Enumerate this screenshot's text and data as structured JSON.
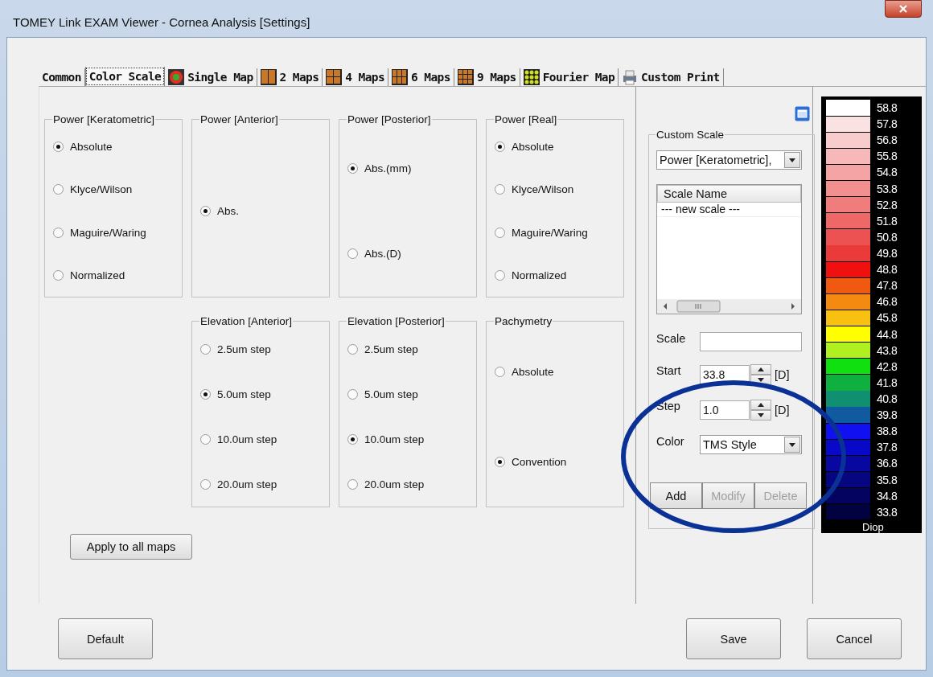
{
  "window": {
    "title": "TOMEY Link EXAM Viewer - Cornea Analysis [Settings]"
  },
  "tabs": [
    {
      "label": "Common",
      "selected": false,
      "kind": "plain"
    },
    {
      "label": "Color Scale",
      "selected": true,
      "kind": "plain"
    },
    {
      "label": "Single Map",
      "selected": false,
      "kind": "single"
    },
    {
      "label": "2 Maps",
      "selected": false,
      "kind": "grid2"
    },
    {
      "label": "4 Maps",
      "selected": false,
      "kind": "grid4"
    },
    {
      "label": "6 Maps",
      "selected": false,
      "kind": "grid6"
    },
    {
      "label": "9 Maps",
      "selected": false,
      "kind": "grid9"
    },
    {
      "label": "Fourier Map",
      "selected": false,
      "kind": "fourier"
    },
    {
      "label": "Custom Print",
      "selected": false,
      "kind": "print"
    }
  ],
  "group_rows": [
    [
      {
        "title": "Power [Keratometric]",
        "options": [
          {
            "label": "Absolute",
            "selected": true
          },
          {
            "label": "Klyce/Wilson",
            "selected": false
          },
          {
            "label": "Maguire/Waring",
            "selected": false
          },
          {
            "label": "Normalized",
            "selected": false
          }
        ]
      },
      {
        "title": "Power [Anterior]",
        "options": [
          {
            "label": "Abs.",
            "selected": true
          }
        ]
      },
      {
        "title": "Power [Posterior]",
        "options": [
          {
            "label": "Abs.(mm)",
            "selected": true
          },
          {
            "label": "Abs.(D)",
            "selected": false
          }
        ]
      },
      {
        "title": "Power [Real]",
        "options": [
          {
            "label": "Absolute",
            "selected": true
          },
          {
            "label": "Klyce/Wilson",
            "selected": false
          },
          {
            "label": "Maguire/Waring",
            "selected": false
          },
          {
            "label": "Normalized",
            "selected": false
          }
        ]
      }
    ],
    [
      {
        "title": "Elevation [Anterior]",
        "options": [
          {
            "label": "2.5um step",
            "selected": false
          },
          {
            "label": "5.0um step",
            "selected": true
          },
          {
            "label": "10.0um step",
            "selected": false
          },
          {
            "label": "20.0um step",
            "selected": false
          }
        ]
      },
      {
        "title": "Elevation [Posterior]",
        "options": [
          {
            "label": "2.5um step",
            "selected": false
          },
          {
            "label": "5.0um step",
            "selected": false
          },
          {
            "label": "10.0um step",
            "selected": true
          },
          {
            "label": "20.0um step",
            "selected": false
          }
        ]
      },
      {
        "title": "Pachymetry",
        "options": [
          {
            "label": "Absolute",
            "selected": false
          },
          {
            "label": "Convention",
            "selected": true
          }
        ]
      }
    ]
  ],
  "apply_button": "Apply to all maps",
  "custom_scale": {
    "title": "Custom Scale",
    "scale_type": "Power [Keratometric],",
    "list": {
      "column": "Scale Name",
      "rows": [
        "--- new scale ---"
      ]
    },
    "scale": {
      "label": "Scale"
    },
    "start": {
      "label": "Start",
      "value": "33.8",
      "unit": "[D]"
    },
    "step": {
      "label": "Step",
      "value": "1.0",
      "unit": "[D]"
    },
    "color": {
      "label": "Color",
      "value": "TMS Style"
    },
    "buttons": [
      {
        "label": "Add",
        "disabled": false
      },
      {
        "label": "Modify",
        "disabled": true
      },
      {
        "label": "Delete",
        "disabled": true
      }
    ]
  },
  "color_bar": {
    "unit": "Diop",
    "bands": [
      {
        "label": "58.8",
        "color": "#ffffff"
      },
      {
        "label": "57.8",
        "color": "#fbe2e2"
      },
      {
        "label": "56.8",
        "color": "#f8cccc"
      },
      {
        "label": "55.8",
        "color": "#f6b8b8"
      },
      {
        "label": "54.8",
        "color": "#f4a4a4"
      },
      {
        "label": "53.8",
        "color": "#f29090"
      },
      {
        "label": "52.8",
        "color": "#f07c7c"
      },
      {
        "label": "51.8",
        "color": "#ee6868"
      },
      {
        "label": "50.8",
        "color": "#ec5252"
      },
      {
        "label": "49.8",
        "color": "#ea3a3a"
      },
      {
        "label": "48.8",
        "color": "#f01010"
      },
      {
        "label": "47.8",
        "color": "#f05a10"
      },
      {
        "label": "46.8",
        "color": "#f58a10"
      },
      {
        "label": "45.8",
        "color": "#f8c010"
      },
      {
        "label": "44.8",
        "color": "#ffff00"
      },
      {
        "label": "43.8",
        "color": "#b0f020"
      },
      {
        "label": "42.8",
        "color": "#10e010"
      },
      {
        "label": "41.8",
        "color": "#10b040"
      },
      {
        "label": "40.8",
        "color": "#109070"
      },
      {
        "label": "39.8",
        "color": "#105aa0"
      },
      {
        "label": "38.8",
        "color": "#1010f0"
      },
      {
        "label": "37.8",
        "color": "#0808c8"
      },
      {
        "label": "36.8",
        "color": "#0808a0"
      },
      {
        "label": "35.8",
        "color": "#060680"
      },
      {
        "label": "34.8",
        "color": "#040460"
      },
      {
        "label": "33.8",
        "color": "#020240"
      }
    ]
  },
  "footer_buttons": [
    "Default",
    "Save",
    "Cancel"
  ]
}
